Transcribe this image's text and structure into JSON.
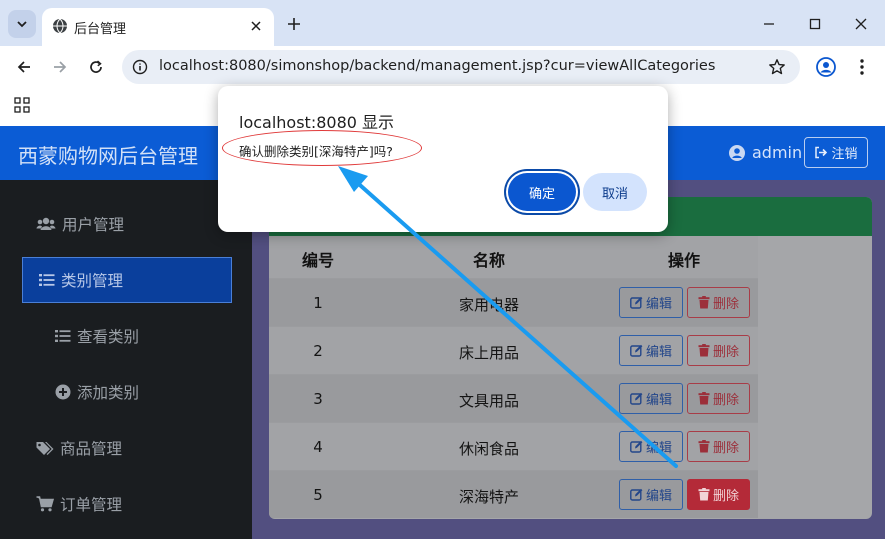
{
  "browser": {
    "tab_title": "后台管理",
    "url": "localhost:8080/simonshop/backend/management.jsp?cur=viewAllCategories"
  },
  "app": {
    "brand": "西蒙购物网后台管理",
    "user": "admin",
    "logout": "注销"
  },
  "sidebar": {
    "items": [
      {
        "label": "用户管理",
        "icon": "users-icon"
      },
      {
        "label": "类别管理",
        "icon": "list-icon",
        "active": true
      },
      {
        "label": "查看类别",
        "icon": "list-icon"
      },
      {
        "label": "添加类别",
        "icon": "plus-circle-icon"
      },
      {
        "label": "商品管理",
        "icon": "tags-icon"
      },
      {
        "label": "订单管理",
        "icon": "cart-icon"
      }
    ]
  },
  "table": {
    "headers": [
      "编号",
      "名称",
      "操作"
    ],
    "rows": [
      {
        "id": "1",
        "name": "家用电器"
      },
      {
        "id": "2",
        "name": "床上用品"
      },
      {
        "id": "3",
        "name": "文具用品"
      },
      {
        "id": "4",
        "name": "休闲食品"
      },
      {
        "id": "5",
        "name": "深海特产"
      }
    ],
    "edit_label": "编辑",
    "delete_label": "删除"
  },
  "dialog": {
    "title": "localhost:8080 显示",
    "message": "确认删除类别[深海特产]吗?",
    "ok": "确定",
    "cancel": "取消"
  },
  "colors": {
    "navbar": "#0b5cd5",
    "sidebar": "#1a1d20",
    "dialog_ok": "#0b57d0",
    "annotation": "#1a9bf0"
  }
}
